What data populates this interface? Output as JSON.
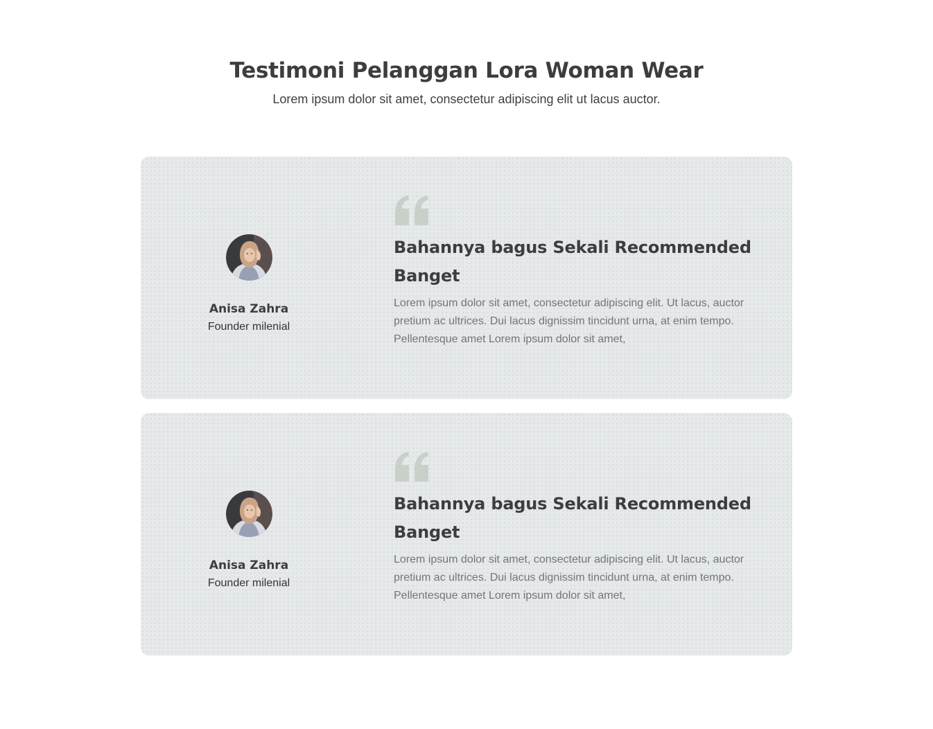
{
  "header": {
    "title": "Testimoni Pelanggan Lora Woman Wear",
    "subtitle": "Lorem ipsum dolor sit amet, consectetur adipiscing elit ut lacus auctor."
  },
  "colors": {
    "card_background": "#e6e9ea",
    "heading": "#3d3d40",
    "body_text": "#73757a",
    "quote_icon": "#c9d0c9"
  },
  "testimonials": [
    {
      "name": "Anisa Zahra",
      "role": "Founder milenial",
      "quote_icon": "quote-open-icon",
      "title": "Bahannya bagus Sekali Recommended Banget",
      "body": "Lorem ipsum dolor sit amet, consectetur adipiscing elit. Ut lacus, auctor pretium ac ultrices. Dui lacus dignissim tincidunt urna, at enim tempo. Pellentesque amet Lorem ipsum dolor sit amet,"
    },
    {
      "name": "Anisa Zahra",
      "role": "Founder milenial",
      "quote_icon": "quote-open-icon",
      "title": "Bahannya bagus Sekali Recommended Banget",
      "body": "Lorem ipsum dolor sit amet, consectetur adipiscing elit. Ut lacus, auctor pretium ac ultrices. Dui lacus dignissim tincidunt urna, at enim tempo. Pellentesque amet Lorem ipsum dolor sit amet,"
    }
  ]
}
